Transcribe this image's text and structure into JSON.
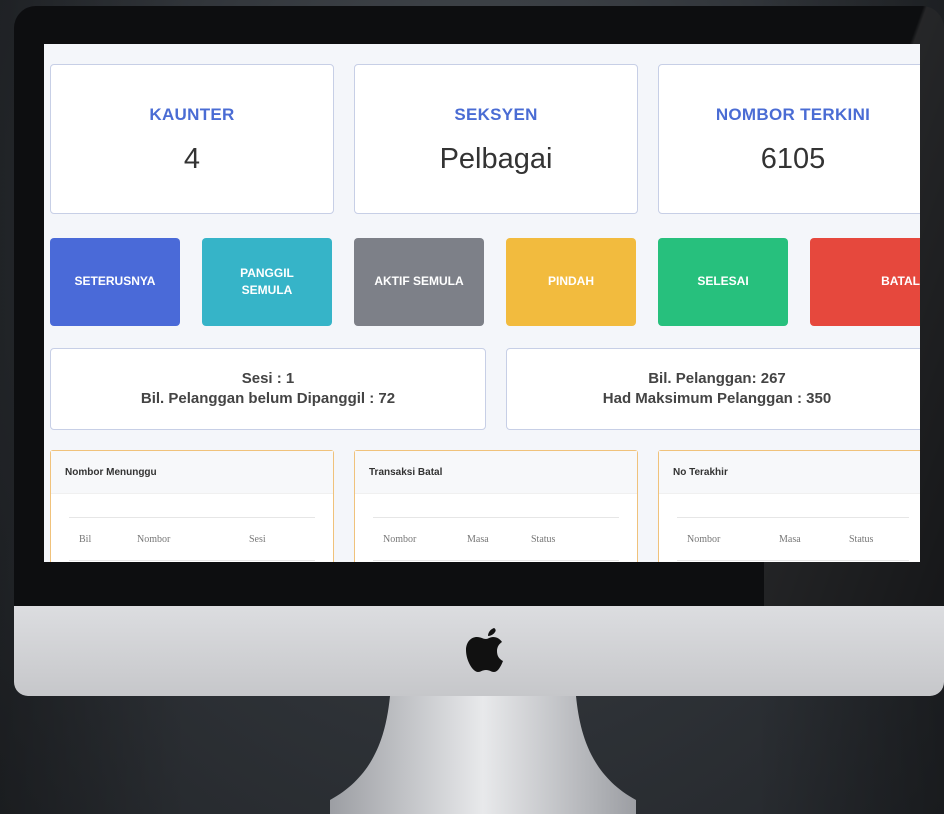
{
  "stats": [
    {
      "label": "KAUNTER",
      "value": "4"
    },
    {
      "label": "SEKSYEN",
      "value": "Pelbagai"
    },
    {
      "label": "NOMBOR TERKINI",
      "value": "6105"
    }
  ],
  "actions": [
    {
      "label": "SETERUSNYA",
      "color": "#4a6ad8"
    },
    {
      "label": "PANGGIL SEMULA",
      "color": "#36b4c8"
    },
    {
      "label": "AKTIF SEMULA",
      "color": "#7d8088"
    },
    {
      "label": "PINDAH",
      "color": "#f2bb3e"
    },
    {
      "label": "SELESAI",
      "color": "#27c07d"
    },
    {
      "label": "BATAL",
      "color": "#e6483d"
    }
  ],
  "session_info": {
    "sesi": "Sesi : 1",
    "belum_dipanggil": "Bil. Pelanggan belum Dipanggil : 72"
  },
  "customer_info": {
    "bil_pelanggan": "Bil. Pelanggan: 267",
    "had_maksimum": "Had Maksimum Pelanggan : 350"
  },
  "panels": [
    {
      "title": "Nombor Menunggu",
      "columns": [
        "Bil",
        "Nombor",
        "Sesi"
      ]
    },
    {
      "title": "Transaksi Batal",
      "columns": [
        "Nombor",
        "Masa",
        "Status"
      ]
    },
    {
      "title": "No Terakhir",
      "columns": [
        "Nombor",
        "Masa",
        "Status"
      ]
    }
  ],
  "icons": {
    "logo": "apple-logo-icon"
  }
}
